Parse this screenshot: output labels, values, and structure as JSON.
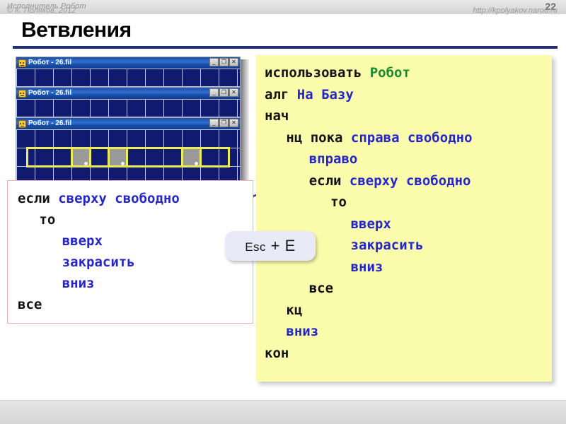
{
  "header": {
    "title": "Исполнитель Робот",
    "page_number": "22"
  },
  "slide": {
    "title": "Ветвления",
    "rule_color": "#1f2d7a"
  },
  "robot_windows": {
    "icon": "robot-face-icon",
    "buttons": {
      "minimize": "_",
      "maximize": "❐",
      "close": "✕"
    },
    "items": [
      {
        "title": "Робот - 26.fil"
      },
      {
        "title": "Робот - 26.fil"
      },
      {
        "title": "Робот - 26.fil"
      }
    ]
  },
  "left_panel": {
    "border_color": "#e8b4bc",
    "lines": [
      {
        "indent": 0,
        "parts": [
          {
            "text": "если",
            "kind": "kw"
          },
          {
            "text": "сверху свободно",
            "kind": "cond"
          }
        ]
      },
      {
        "indent": 1,
        "parts": [
          {
            "text": "то",
            "kind": "kw"
          }
        ]
      },
      {
        "indent": 2,
        "parts": [
          {
            "text": "вверх",
            "kind": "cmd"
          }
        ]
      },
      {
        "indent": 2,
        "parts": [
          {
            "text": "закрасить",
            "kind": "cmd"
          }
        ]
      },
      {
        "indent": 2,
        "parts": [
          {
            "text": "вниз",
            "kind": "cmd"
          }
        ]
      },
      {
        "indent": 0,
        "parts": [
          {
            "text": "все",
            "kind": "kw"
          }
        ]
      }
    ]
  },
  "right_panel": {
    "background_color": "#fbfbac",
    "lines": [
      {
        "indent": 0,
        "parts": [
          {
            "text": "использовать",
            "kind": "kw"
          },
          {
            "text": "Робот",
            "kind": "proc"
          }
        ]
      },
      {
        "indent": 0,
        "parts": [
          {
            "text": "алг",
            "kind": "kw"
          },
          {
            "text": "На Базу",
            "kind": "cmd"
          }
        ]
      },
      {
        "indent": 0,
        "parts": [
          {
            "text": "нач",
            "kind": "kw"
          }
        ]
      },
      {
        "indent": 1,
        "parts": [
          {
            "text": "нц пока",
            "kind": "kw"
          },
          {
            "text": "справа свободно",
            "kind": "cond"
          }
        ]
      },
      {
        "indent": 2,
        "parts": [
          {
            "text": "вправо",
            "kind": "cmd"
          }
        ]
      },
      {
        "indent": 2,
        "parts": [
          {
            "text": "если",
            "kind": "kw"
          },
          {
            "text": "сверху свободно",
            "kind": "cond"
          }
        ]
      },
      {
        "indent": 3,
        "parts": [
          {
            "text": "то",
            "kind": "kw"
          }
        ]
      },
      {
        "indent": 4,
        "parts": [
          {
            "text": "вверх",
            "kind": "cmd"
          }
        ]
      },
      {
        "indent": 4,
        "parts": [
          {
            "text": "закрасить",
            "kind": "cmd"
          }
        ]
      },
      {
        "indent": 4,
        "parts": [
          {
            "text": "вниз",
            "kind": "cmd"
          }
        ]
      },
      {
        "indent": 2,
        "parts": [
          {
            "text": "все",
            "kind": "kw"
          }
        ]
      },
      {
        "indent": 1,
        "parts": [
          {
            "text": "кц",
            "kind": "kw"
          }
        ]
      },
      {
        "indent": 1,
        "parts": [
          {
            "text": "вниз",
            "kind": "cmd"
          }
        ]
      },
      {
        "indent": 0,
        "parts": [
          {
            "text": "кон",
            "kind": "kw"
          }
        ]
      }
    ]
  },
  "callout": {
    "prefix": "Esc",
    "suffix": " + E",
    "full_text": "Esc + E",
    "background_color": "#e9e9f7"
  },
  "footer": {
    "copyright": "© К. Поляков, 2012",
    "url": "http://kpolyakov.narod.ru"
  },
  "colors": {
    "keyword": "#111111",
    "command": "#2525cc",
    "condition": "#2525cc",
    "procedure": "#1a8a2e",
    "canvas_navy": "#101a6e",
    "wall_yellow": "#eded5a",
    "painted_gray": "#9a9a9a"
  }
}
